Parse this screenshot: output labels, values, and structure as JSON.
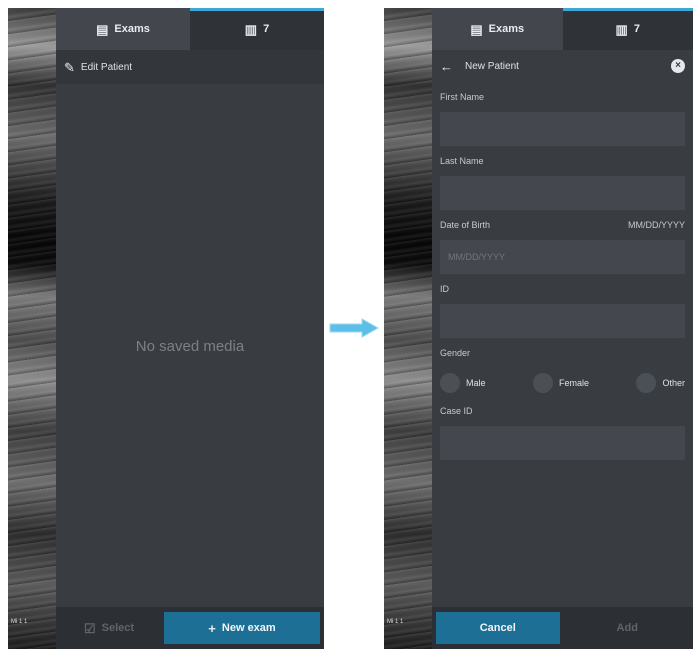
{
  "left": {
    "tabs": [
      {
        "label": "Exams",
        "icon": "exam-list-icon"
      },
      {
        "label": "7",
        "icon": "patient-icon"
      }
    ],
    "header": {
      "label": "Edit Patient",
      "icon": "pencil-icon"
    },
    "empty_message": "No saved media",
    "footer": {
      "select_label": "Select",
      "new_exam_label": "New exam"
    },
    "scan_label": "Mi 1 1"
  },
  "arrow": {
    "icon": "right-arrow-icon",
    "color": "#5bbfe8"
  },
  "right": {
    "tabs": [
      {
        "label": "Exams",
        "icon": "exam-list-icon"
      },
      {
        "label": "7",
        "icon": "patient-icon"
      }
    ],
    "header": {
      "label": "New Patient",
      "icon": "back-arrow-icon",
      "close_icon": "close-icon"
    },
    "form": {
      "first_name_label": "First Name",
      "last_name_label": "Last Name",
      "dob_label": "Date of Birth",
      "dob_format": "MM/DD/YYYY",
      "dob_placeholder": "MM/DD/YYYY",
      "id_label": "ID",
      "gender_label": "Gender",
      "gender_options": [
        "Male",
        "Female",
        "Other"
      ],
      "case_id_label": "Case ID"
    },
    "footer": {
      "cancel_label": "Cancel",
      "add_label": "Add"
    },
    "scan_label": "Mi 1 1"
  },
  "colors": {
    "accent": "#1e6f96",
    "panel": "#393d42",
    "tab_indicator": "#3fa9d6"
  }
}
